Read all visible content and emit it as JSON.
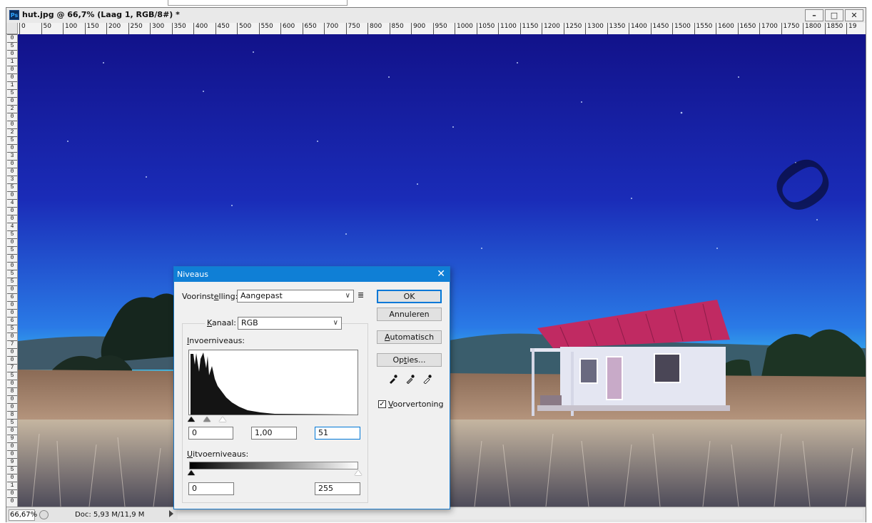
{
  "window": {
    "app_icon": "Ps",
    "title": "hut.jpg @ 66,7% (Laag 1, RGB/8#) *",
    "controls": [
      "minimize-icon",
      "maximize-icon",
      "close-icon"
    ]
  },
  "ruler": {
    "h_labels": [
      "0",
      "50",
      "100",
      "150",
      "200",
      "250",
      "300",
      "350",
      "400",
      "450",
      "500",
      "550",
      "600",
      "650",
      "700",
      "750",
      "800",
      "850",
      "900",
      "950",
      "1000",
      "1050",
      "1100",
      "1150",
      "1200",
      "1250",
      "1300",
      "1350",
      "1400",
      "1450",
      "1500",
      "1550",
      "1600",
      "1650",
      "1700",
      "1750",
      "1800",
      "1850",
      "19"
    ],
    "v_labels": [
      "0",
      "5",
      "0",
      "1",
      "0",
      "0",
      "1",
      "5",
      "0",
      "2",
      "0",
      "0",
      "2",
      "5",
      "0",
      "3",
      "0",
      "0",
      "3",
      "5",
      "0",
      "4",
      "0",
      "0",
      "4",
      "5",
      "0",
      "5",
      "0",
      "0",
      "5",
      "5",
      "0",
      "6",
      "0",
      "0",
      "6",
      "5",
      "0",
      "7",
      "0",
      "0",
      "7",
      "5",
      "0",
      "8",
      "0",
      "0",
      "8",
      "5",
      "0",
      "9",
      "0",
      "0",
      "9",
      "5",
      "0",
      "1",
      "0",
      "0"
    ]
  },
  "status": {
    "zoom": "66,67%",
    "doc": "Doc: 5,93 M/11,9 M"
  },
  "dialog": {
    "title": "Niveaus",
    "preset_label_pre": "Voorinst",
    "preset_label_mn": "e",
    "preset_label_post": "lling:",
    "preset_value": "Aangepast",
    "channel_label_mn": "K",
    "channel_label_post": "anaal:",
    "channel_value": "RGB",
    "input_label_mn": "I",
    "input_label_post": "nvoerniveaus:",
    "input_black": "0",
    "input_gamma": "1,00",
    "input_white": "51",
    "output_label_mn": "U",
    "output_label_post": "itvoerniveaus:",
    "output_black": "0",
    "output_white": "255",
    "buttons": {
      "ok": "OK",
      "cancel": "Annuleren",
      "auto_mn": "A",
      "auto_post": "utomatisch",
      "options_pre": "Op",
      "options_mn": "t",
      "options_post": "ies..."
    },
    "preview_mn": "V",
    "preview_post": "oorvertoning",
    "preview_checked": true
  }
}
